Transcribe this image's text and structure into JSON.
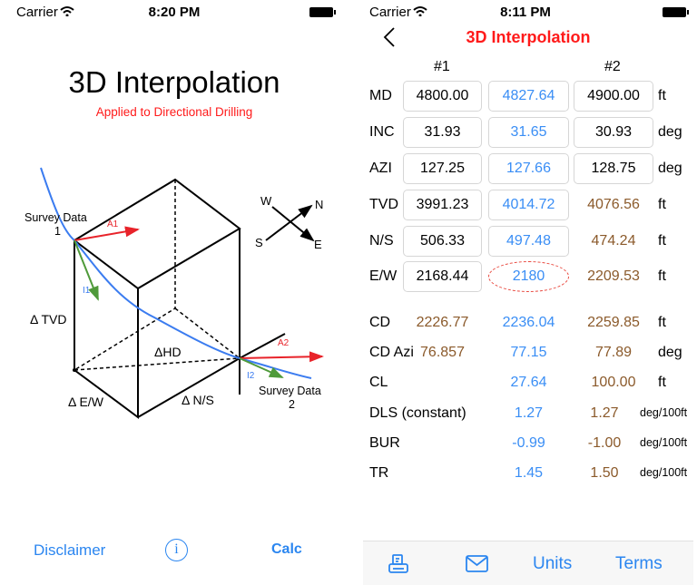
{
  "left_screen": {
    "status": {
      "carrier": "Carrier",
      "time": "8:20 PM"
    },
    "title": "3D Interpolation",
    "subtitle": "Applied to Directional Drilling",
    "diagram": {
      "survey1": "Survey Data",
      "survey1_num": "1",
      "survey2": "Survey Data",
      "survey2_num": "2",
      "a1": "A1",
      "i1": "I1",
      "a2": "A2",
      "i2": "I2",
      "dtvd": "Δ TVD",
      "dhd": "ΔHD",
      "dew": "Δ E/W",
      "dns": "Δ N/S",
      "compass": {
        "w": "W",
        "n": "N",
        "s": "S",
        "e": "E"
      }
    },
    "footer": {
      "disclaimer": "Disclaimer",
      "info": "i",
      "calc": "Calc"
    }
  },
  "right_screen": {
    "status": {
      "carrier": "Carrier",
      "time": "8:11 PM"
    },
    "nav": {
      "title": "3D Interpolation"
    },
    "headers": [
      "#1",
      "#2"
    ],
    "input_rows": [
      {
        "label": "MD",
        "v1": "4800.00",
        "v2": "4827.64",
        "v3": "4900.00",
        "unit": "ft",
        "v3_boxed": true
      },
      {
        "label": "INC",
        "v1": "31.93",
        "v2": "31.65",
        "v3": "30.93",
        "unit": "deg",
        "v3_boxed": true
      },
      {
        "label": "AZI",
        "v1": "127.25",
        "v2": "127.66",
        "v3": "128.75",
        "unit": "deg",
        "v3_boxed": true
      },
      {
        "label": "TVD",
        "v1": "3991.23",
        "v2": "4014.72",
        "v3": "4076.56",
        "unit": "ft",
        "v3_boxed": false
      },
      {
        "label": "N/S",
        "v1": "506.33",
        "v2": "497.48",
        "v3": "474.24",
        "unit": "ft",
        "v3_boxed": false
      },
      {
        "label": "E/W",
        "v1": "2168.44",
        "v2": "2180",
        "v3": "2209.53",
        "unit": "ft",
        "v3_boxed": false
      }
    ],
    "result_rows": [
      {
        "label": "CD",
        "v1": "2226.77",
        "v2": "2236.04",
        "v3": "2259.85",
        "unit": "ft"
      },
      {
        "label": "CD Azi",
        "v1": "76.857",
        "v2": "77.15",
        "v3": "77.89",
        "unit": "deg"
      },
      {
        "label": "CL",
        "v1": "",
        "v2": "27.64",
        "v3": "100.00",
        "unit": "ft"
      },
      {
        "label": "DLS (constant)",
        "v1": "",
        "v2": "1.27",
        "v3": "1.27",
        "unit": "deg/100ft"
      },
      {
        "label": "BUR",
        "v1": "",
        "v2": "-0.99",
        "v3": "-1.00",
        "unit": "deg/100ft"
      },
      {
        "label": "TR",
        "v1": "",
        "v2": "1.45",
        "v3": "1.50",
        "unit": "deg/100ft"
      }
    ],
    "tabbar": {
      "units": "Units",
      "terms": "Terms"
    }
  },
  "colors": {
    "accent_blue": "#2b86f0",
    "value_blue": "#3a8ef5",
    "brown": "#8b5a2b",
    "red": "#ff1a1a"
  }
}
